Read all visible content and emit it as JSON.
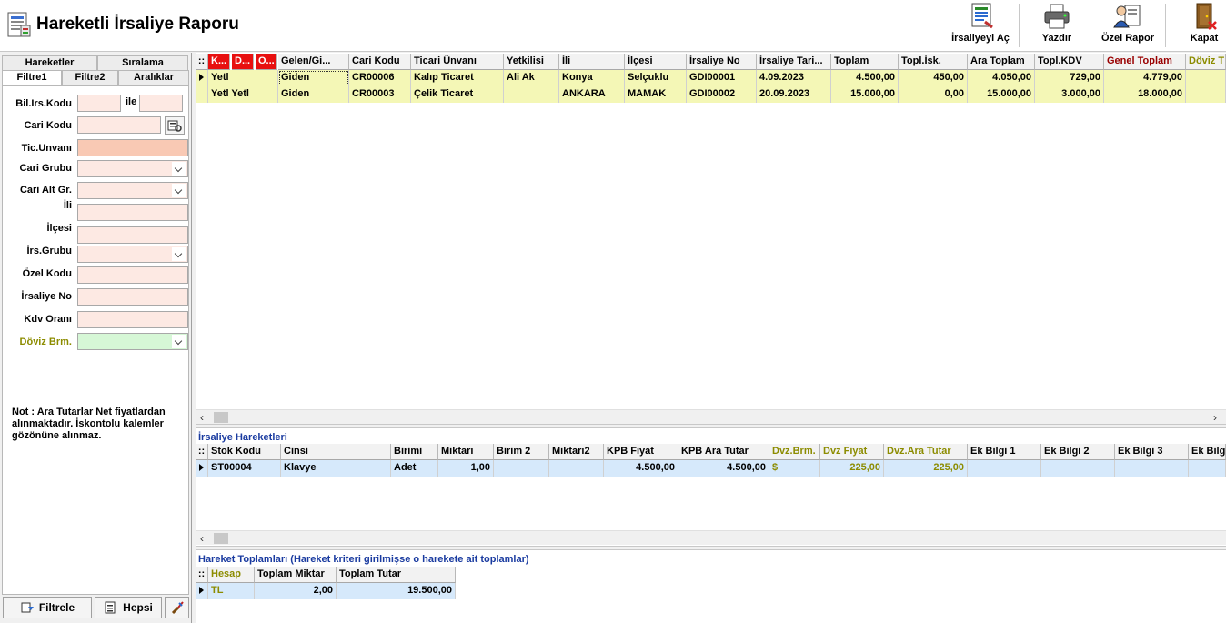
{
  "window": {
    "title": "Hareketli İrsaliye Raporu"
  },
  "toolbar": {
    "open_label": "İrsaliyeyi Aç",
    "print_label": "Yazdır",
    "custom_report_label": "Özel Rapor",
    "close_label": "Kapat"
  },
  "left_tabs": {
    "row1": [
      "Hareketler",
      "Sıralama"
    ],
    "row2": [
      "Filtre1",
      "Filtre2",
      "Aralıklar"
    ]
  },
  "filters": {
    "bil_irs_kodu": {
      "label": "Bil.Irs.Kodu",
      "value_from": "",
      "ile": "ile",
      "value_to": ""
    },
    "cari_kodu": {
      "label": "Cari Kodu",
      "value": ""
    },
    "tic_unvani": {
      "label": "Tic.Unvanı",
      "value": ""
    },
    "cari_grubu": {
      "label": "Cari Grubu",
      "value": ""
    },
    "cari_alt_gr": {
      "label": "Cari Alt Gr.",
      "value": ""
    },
    "ili": {
      "label": "İli",
      "value": ""
    },
    "ilcesi": {
      "label": "İlçesi",
      "value": ""
    },
    "irs_grubu": {
      "label": "İrs.Grubu",
      "value": ""
    },
    "ozel_kodu": {
      "label": "Özel Kodu",
      "value": ""
    },
    "irsaliye_no": {
      "label": "İrsaliye No",
      "value": ""
    },
    "kdv_orani": {
      "label": "Kdv Oranı",
      "value": ""
    },
    "doviz_brm": {
      "label": "Döviz Brm.",
      "value": ""
    }
  },
  "note": "Not : Ara Tutarlar Net fiyatlardan alınmaktadır. İskontolu kalemler gözönüne alınmaz.",
  "buttons": {
    "filter": "Filtrele",
    "all": "Hepsi"
  },
  "main_grid": {
    "headers": [
      "K...",
      "D...",
      "O...",
      "Gelen/Gi...",
      "Cari Kodu",
      "Ticari Ünvanı",
      "Yetkilisi",
      "İli",
      "İlçesi",
      "İrsaliye No",
      "İrsaliye Tari...",
      "Toplam",
      "Topl.İsk.",
      "Ara Toplam",
      "Topl.KDV",
      "Genel Toplam",
      "Döviz T"
    ],
    "rows": [
      [
        "Yetl",
        "",
        "",
        "Giden",
        "CR00006",
        "Kalıp Ticaret",
        "Ali Ak",
        "Konya",
        "Selçuklu",
        "GDI00001",
        "4.09.2023",
        "4.500,00",
        "450,00",
        "4.050,00",
        "729,00",
        "4.779,00",
        ""
      ],
      [
        "Yetl Yetl",
        "",
        "",
        "Giden",
        "CR00003",
        "Çelik Ticaret",
        "",
        "ANKARA",
        "MAMAK",
        "GDI00002",
        "20.09.2023",
        "15.000,00",
        "0,00",
        "15.000,00",
        "3.000,00",
        "18.000,00",
        ""
      ]
    ]
  },
  "movements": {
    "title": "İrsaliye Hareketleri",
    "headers": [
      "Stok Kodu",
      "Cinsi",
      "Birimi",
      "Miktarı",
      "Birim 2",
      "Miktarı2",
      "KPB Fiyat",
      "KPB Ara Tutar",
      "Dvz.Brm.",
      "Dvz Fiyat",
      "Dvz.Ara Tutar",
      "Ek Bilgi 1",
      "Ek Bilgi 2",
      "Ek Bilgi 3",
      "Ek Bilgi"
    ],
    "rows": [
      [
        "ST00004",
        "Klavye",
        "Adet",
        "1,00",
        "",
        "",
        "4.500,00",
        "4.500,00",
        "$",
        "225,00",
        "225,00",
        "",
        "",
        "",
        ""
      ]
    ]
  },
  "totals": {
    "title": "Hareket Toplamları (Hareket kriteri girilmişse o harekete ait toplamlar)",
    "headers": [
      "Hesap",
      "Toplam Miktar",
      "Toplam Tutar"
    ],
    "rows": [
      [
        "TL",
        "2,00",
        "19.500,00"
      ]
    ]
  },
  "colors": {
    "accent_blue": "#1a3ba0",
    "row_yellow": "#f4f7b6",
    "row_blue": "#d6e9fb",
    "header_red": "#e81010",
    "olive": "#8c8c00",
    "maroon": "#990000"
  }
}
